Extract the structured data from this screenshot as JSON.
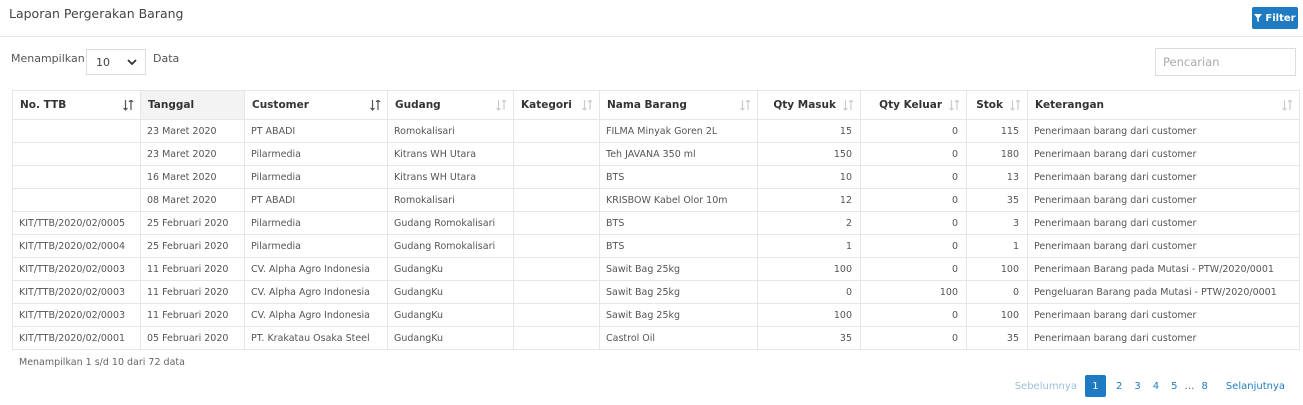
{
  "header": {
    "title": "Laporan Pergerakan Barang",
    "filter_label": "Filter"
  },
  "controls": {
    "length_prefix": "Menampilkan",
    "length_value": "10",
    "length_suffix": "Data",
    "search_placeholder": "Pencarian"
  },
  "table": {
    "columns": [
      "No. TTB",
      "Tanggal",
      "Customer",
      "Gudang",
      "Kategori",
      "Nama Barang",
      "Qty Masuk",
      "Qty Keluar",
      "Stok",
      "Keterangan"
    ],
    "rows": [
      [
        "",
        "23 Maret 2020",
        "PT ABADI",
        "Romokalisari",
        "",
        "FILMA Minyak Goren 2L",
        "15",
        "0",
        "115",
        "Penerimaan barang dari customer"
      ],
      [
        "",
        "23 Maret 2020",
        "Pilarmedia",
        "Kitrans WH Utara",
        "",
        "Teh JAVANA 350 ml",
        "150",
        "0",
        "180",
        "Penerimaan barang dari customer"
      ],
      [
        "",
        "16 Maret 2020",
        "Pilarmedia",
        "Kitrans WH Utara",
        "",
        "BTS",
        "10",
        "0",
        "13",
        "Penerimaan barang dari customer"
      ],
      [
        "",
        "08 Maret 2020",
        "PT ABADI",
        "Romokalisari",
        "",
        "KRISBOW Kabel Olor 10m",
        "12",
        "0",
        "35",
        "Penerimaan barang dari customer"
      ],
      [
        "KIT/TTB/2020/02/0005",
        "25 Februari 2020",
        "Pilarmedia",
        "Gudang Romokalisari",
        "",
        "BTS",
        "2",
        "0",
        "3",
        "Penerimaan barang dari customer"
      ],
      [
        "KIT/TTB/2020/02/0004",
        "25 Februari 2020",
        "Pilarmedia",
        "Gudang Romokalisari",
        "",
        "BTS",
        "1",
        "0",
        "1",
        "Penerimaan barang dari customer"
      ],
      [
        "KIT/TTB/2020/02/0003",
        "11 Februari 2020",
        "CV. Alpha Agro Indonesia",
        "GudangKu",
        "",
        "Sawit Bag 25kg",
        "100",
        "0",
        "100",
        "Penerimaan Barang pada Mutasi - PTW/2020/0001"
      ],
      [
        "KIT/TTB/2020/02/0003",
        "11 Februari 2020",
        "CV. Alpha Agro Indonesia",
        "GudangKu",
        "",
        "Sawit Bag 25kg",
        "0",
        "100",
        "0",
        "Pengeluaran Barang pada Mutasi - PTW/2020/0001"
      ],
      [
        "KIT/TTB/2020/02/0003",
        "11 Februari 2020",
        "CV. Alpha Agro Indonesia",
        "GudangKu",
        "",
        "Sawit Bag 25kg",
        "100",
        "0",
        "100",
        "Penerimaan barang dari customer"
      ],
      [
        "KIT/TTB/2020/02/0001",
        "05 Februari 2020",
        "PT. Krakatau Osaka Steel",
        "GudangKu",
        "",
        "Castrol Oil",
        "35",
        "0",
        "35",
        "Penerimaan barang dari customer"
      ]
    ]
  },
  "footer": {
    "info": "Menampilkan 1 s/d 10 dari 72 data",
    "pagination": {
      "prev": "Sebelumnya",
      "pages": [
        "1",
        "2",
        "3",
        "4",
        "5"
      ],
      "ellipsis": "…",
      "last": "8",
      "next": "Selanjutnya",
      "active": "1"
    }
  },
  "colors": {
    "accent": "#1f7bc1",
    "border": "#e6e6e6",
    "sorted_header_bg": "#f3f3f3"
  }
}
